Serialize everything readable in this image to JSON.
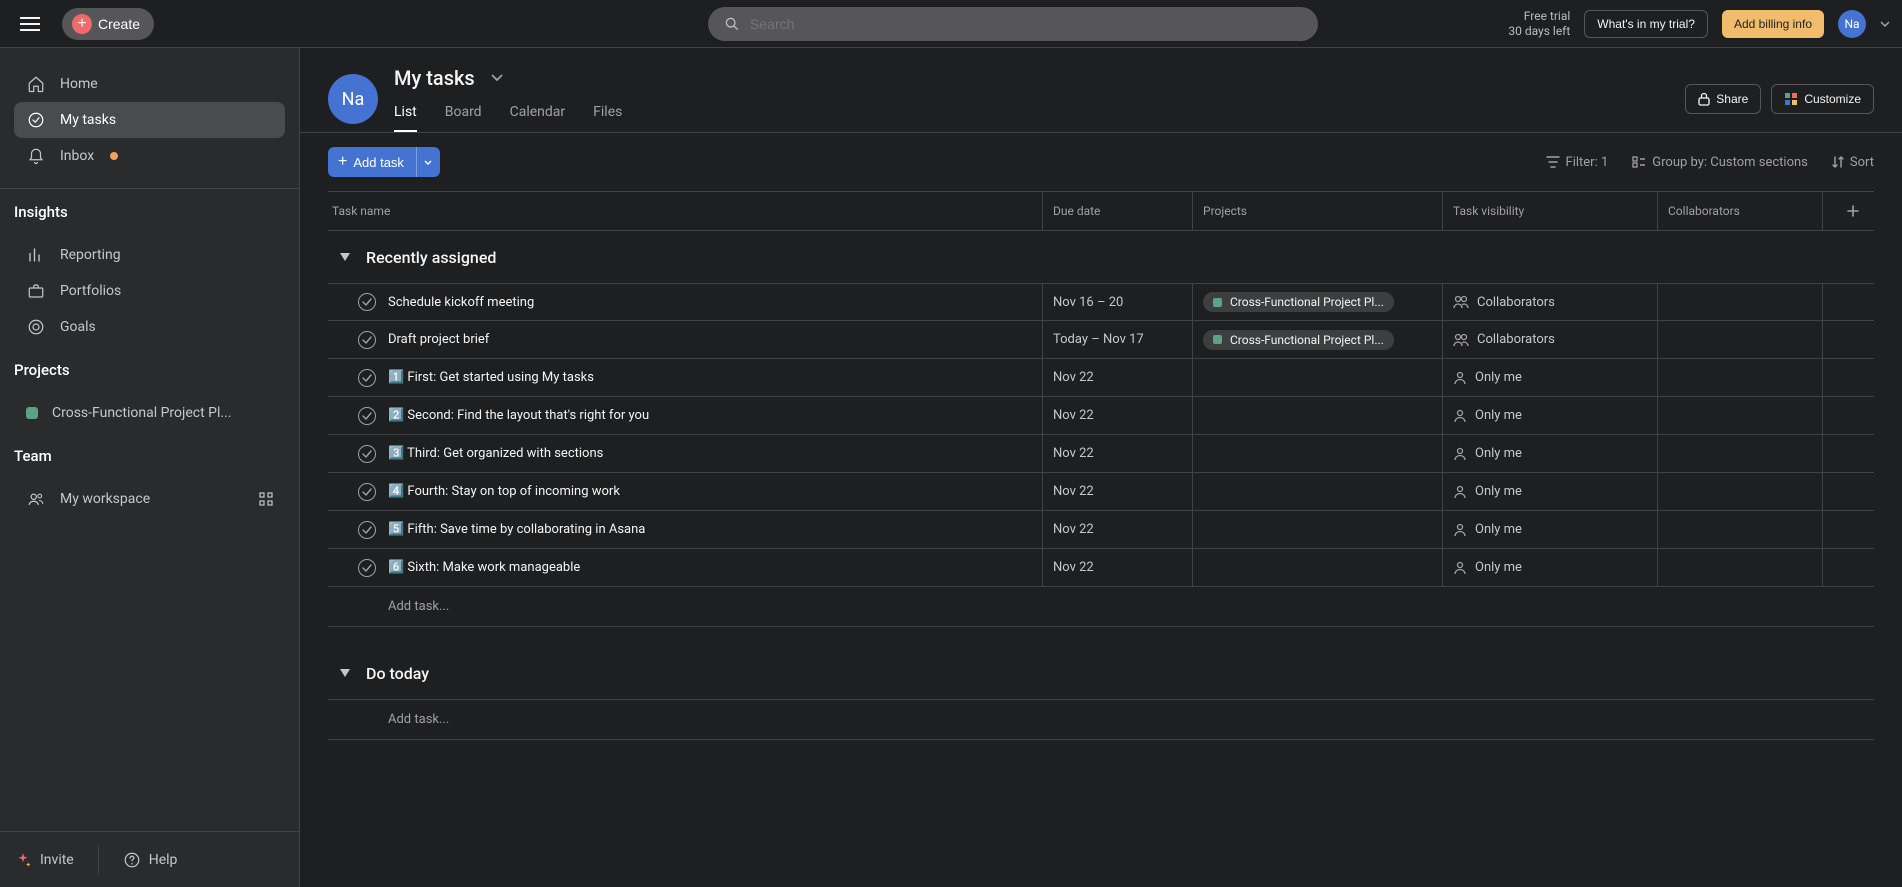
{
  "topbar": {
    "create_label": "Create",
    "search_placeholder": "Search",
    "trial_line1": "Free trial",
    "trial_line2": "30 days left",
    "whats_trial": "What's in my trial?",
    "billing": "Add billing info",
    "avatar": "Na"
  },
  "sidebar": {
    "home": "Home",
    "my_tasks": "My tasks",
    "inbox": "Inbox",
    "insights_header": "Insights",
    "reporting": "Reporting",
    "portfolios": "Portfolios",
    "goals": "Goals",
    "projects_header": "Projects",
    "project_1": "Cross-Functional Project Pl...",
    "team_header": "Team",
    "workspace": "My workspace",
    "invite": "Invite",
    "help": "Help"
  },
  "header": {
    "avatar": "Na",
    "title": "My tasks",
    "share": "Share",
    "customize": "Customize",
    "tabs": {
      "list": "List",
      "board": "Board",
      "calendar": "Calendar",
      "files": "Files"
    }
  },
  "toolbar": {
    "add_task": "Add task",
    "filter": "Filter: 1",
    "group_by": "Group by: Custom sections",
    "sort": "Sort"
  },
  "columns": {
    "name": "Task name",
    "due": "Due date",
    "projects": "Projects",
    "visibility": "Task visibility",
    "collaborators": "Collaborators"
  },
  "sections": {
    "recent": "Recently assigned",
    "today": "Do today",
    "add_task": "Add task..."
  },
  "visibility": {
    "collaborators": "Collaborators",
    "only_me": "Only me"
  },
  "project_pill": "Cross-Functional Project Pl...",
  "tasks": [
    {
      "name": "Schedule kickoff meeting",
      "due": "Nov 16 – 20",
      "project": true,
      "vis": "collaborators"
    },
    {
      "name": "Draft project brief",
      "due": "Today – Nov 17",
      "project": true,
      "vis": "collaborators"
    },
    {
      "name": "1️⃣ First: Get started using My tasks",
      "due": "Nov 22",
      "project": false,
      "vis": "only_me"
    },
    {
      "name": "2️⃣ Second: Find the layout that's right for you",
      "due": "Nov 22",
      "project": false,
      "vis": "only_me"
    },
    {
      "name": "3️⃣ Third: Get organized with sections",
      "due": "Nov 22",
      "project": false,
      "vis": "only_me"
    },
    {
      "name": "4️⃣ Fourth: Stay on top of incoming work",
      "due": "Nov 22",
      "project": false,
      "vis": "only_me"
    },
    {
      "name": "5️⃣ Fifth: Save time by collaborating in Asana",
      "due": "Nov 22",
      "project": false,
      "vis": "only_me"
    },
    {
      "name": "6️⃣ Sixth: Make work manageable",
      "due": "Nov 22",
      "project": false,
      "vis": "only_me"
    }
  ]
}
